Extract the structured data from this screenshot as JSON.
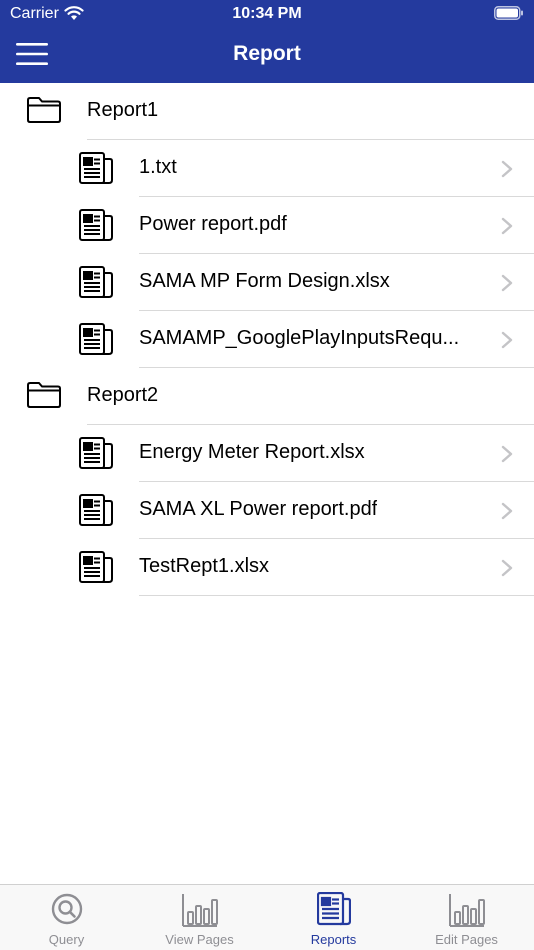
{
  "status_bar": {
    "carrier": "Carrier",
    "time": "10:34 PM"
  },
  "header": {
    "title": "Report"
  },
  "sections": [
    {
      "folder": "Report1",
      "files": [
        "1.txt",
        "Power report.pdf",
        "SAMA MP Form Design.xlsx",
        "SAMAMP_GooglePlayInputsRequ..."
      ]
    },
    {
      "folder": "Report2",
      "files": [
        "Energy Meter Report.xlsx",
        "SAMA XL Power report.pdf",
        "TestRept1.xlsx"
      ]
    }
  ],
  "tabbar": {
    "tabs": [
      {
        "label": "Query",
        "icon": "search-icon"
      },
      {
        "label": "View Pages",
        "icon": "bar-chart-icon"
      },
      {
        "label": "Reports",
        "icon": "report-icon"
      },
      {
        "label": "Edit Pages",
        "icon": "bar-chart-icon"
      }
    ],
    "active": "Reports"
  },
  "colors": {
    "header": "#243a9e",
    "active_tab": "#243a9e",
    "inactive_tab": "#8e8e93"
  }
}
